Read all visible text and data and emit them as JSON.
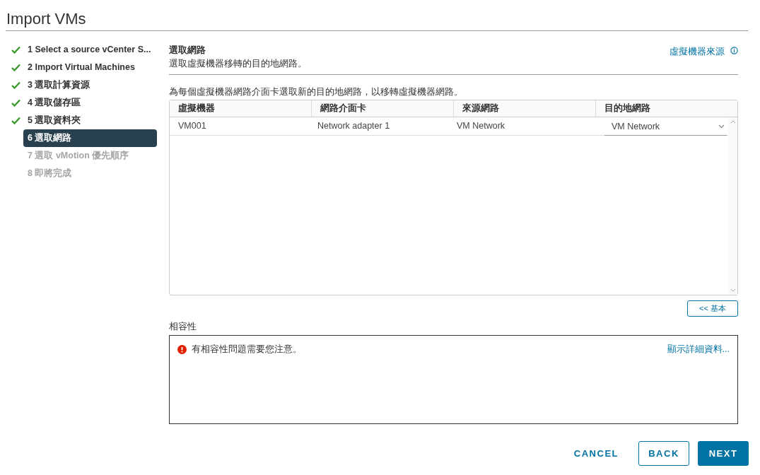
{
  "window": {
    "title": "Import VMs"
  },
  "steps": [
    {
      "label": "1 Select a source vCenter S...",
      "completed": true,
      "selected": false,
      "disabled": false
    },
    {
      "label": "2 Import Virtual Machines",
      "completed": true,
      "selected": false,
      "disabled": false
    },
    {
      "label": "3 選取計算資源",
      "completed": true,
      "selected": false,
      "disabled": false
    },
    {
      "label": "4 選取儲存區",
      "completed": true,
      "selected": false,
      "disabled": false
    },
    {
      "label": "5 選取資料夾",
      "completed": true,
      "selected": false,
      "disabled": false
    },
    {
      "label": "6 選取網路",
      "completed": false,
      "selected": true,
      "disabled": false
    },
    {
      "label": "7 選取 vMotion 優先順序",
      "completed": false,
      "selected": false,
      "disabled": true
    },
    {
      "label": "8 即將完成",
      "completed": false,
      "selected": false,
      "disabled": true
    }
  ],
  "page": {
    "heading": "選取網路",
    "subheading": "選取虛擬機器移轉的目的地網路。",
    "source_link": "虛擬機器來源"
  },
  "instruction": "為每個虛擬機器網路介面卡選取新的目的地網路，以移轉虛擬機器網路。",
  "table": {
    "columns": [
      "虛擬機器",
      "網路介面卡",
      "來源網路",
      "目的地網路"
    ],
    "rows": [
      {
        "vm": "VM001",
        "adapter": "Network adapter 1",
        "source": "VM Network",
        "destination": "VM Network"
      }
    ]
  },
  "basic_button": "<< 基本",
  "compatibility": {
    "label": "相容性",
    "message": "有相容性問題需要您注意。",
    "details_link": "顯示詳細資料..."
  },
  "buttons": {
    "cancel": "CANCEL",
    "back": "BACK",
    "next": "NEXT"
  }
}
